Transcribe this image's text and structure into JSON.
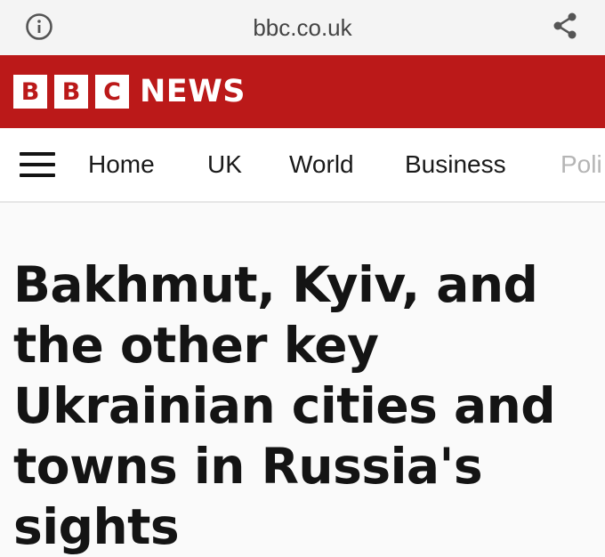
{
  "browser": {
    "url": "bbc.co.uk",
    "icons": {
      "left": "info-icon",
      "right": "share-icon"
    }
  },
  "masthead": {
    "logo_letters": [
      "B",
      "B",
      "C"
    ],
    "logo_word": "NEWS",
    "background_color": "#bb1919"
  },
  "nav": {
    "items": [
      {
        "label": "Home"
      },
      {
        "label": "UK"
      },
      {
        "label": "World"
      },
      {
        "label": "Business"
      },
      {
        "label": "Poli"
      }
    ]
  },
  "article": {
    "headline": "Bakhmut, Kyiv, and the other key Ukrainian cities and towns in Russia's sights"
  }
}
